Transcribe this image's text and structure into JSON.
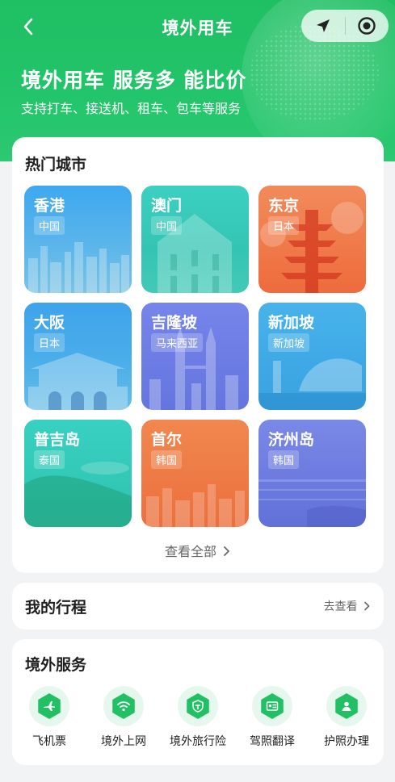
{
  "nav": {
    "title": "境外用车"
  },
  "hero": {
    "title": "境外用车 服务多 能比价",
    "subtitle": "支持打车、接送机、租车、包车等服务"
  },
  "hot_cities": {
    "title": "热门城市",
    "view_all": "查看全部",
    "cities": [
      {
        "name": "香港",
        "country": "中国"
      },
      {
        "name": "澳门",
        "country": "中国"
      },
      {
        "name": "东京",
        "country": "日本"
      },
      {
        "name": "大阪",
        "country": "日本"
      },
      {
        "name": "吉隆坡",
        "country": "马来西亚"
      },
      {
        "name": "新加坡",
        "country": "新加坡"
      },
      {
        "name": "普吉岛",
        "country": "泰国"
      },
      {
        "name": "首尔",
        "country": "韩国"
      },
      {
        "name": "济州岛",
        "country": "韩国"
      }
    ]
  },
  "trip": {
    "title": "我的行程",
    "link": "去查看"
  },
  "services": {
    "title": "境外服务",
    "items": [
      {
        "label": "飞机票",
        "icon": "airplane-icon"
      },
      {
        "label": "境外上网",
        "icon": "wifi-icon"
      },
      {
        "label": "境外旅行险",
        "icon": "insurance-icon"
      },
      {
        "label": "驾照翻译",
        "icon": "license-icon"
      },
      {
        "label": "护照办理",
        "icon": "passport-icon"
      }
    ]
  },
  "colors": {
    "brand_green": "#22c064",
    "city_blue": "#3aa0e8",
    "city_teal": "#2fc8b8",
    "city_orange": "#f07a4a",
    "city_purple": "#6f7de6"
  }
}
